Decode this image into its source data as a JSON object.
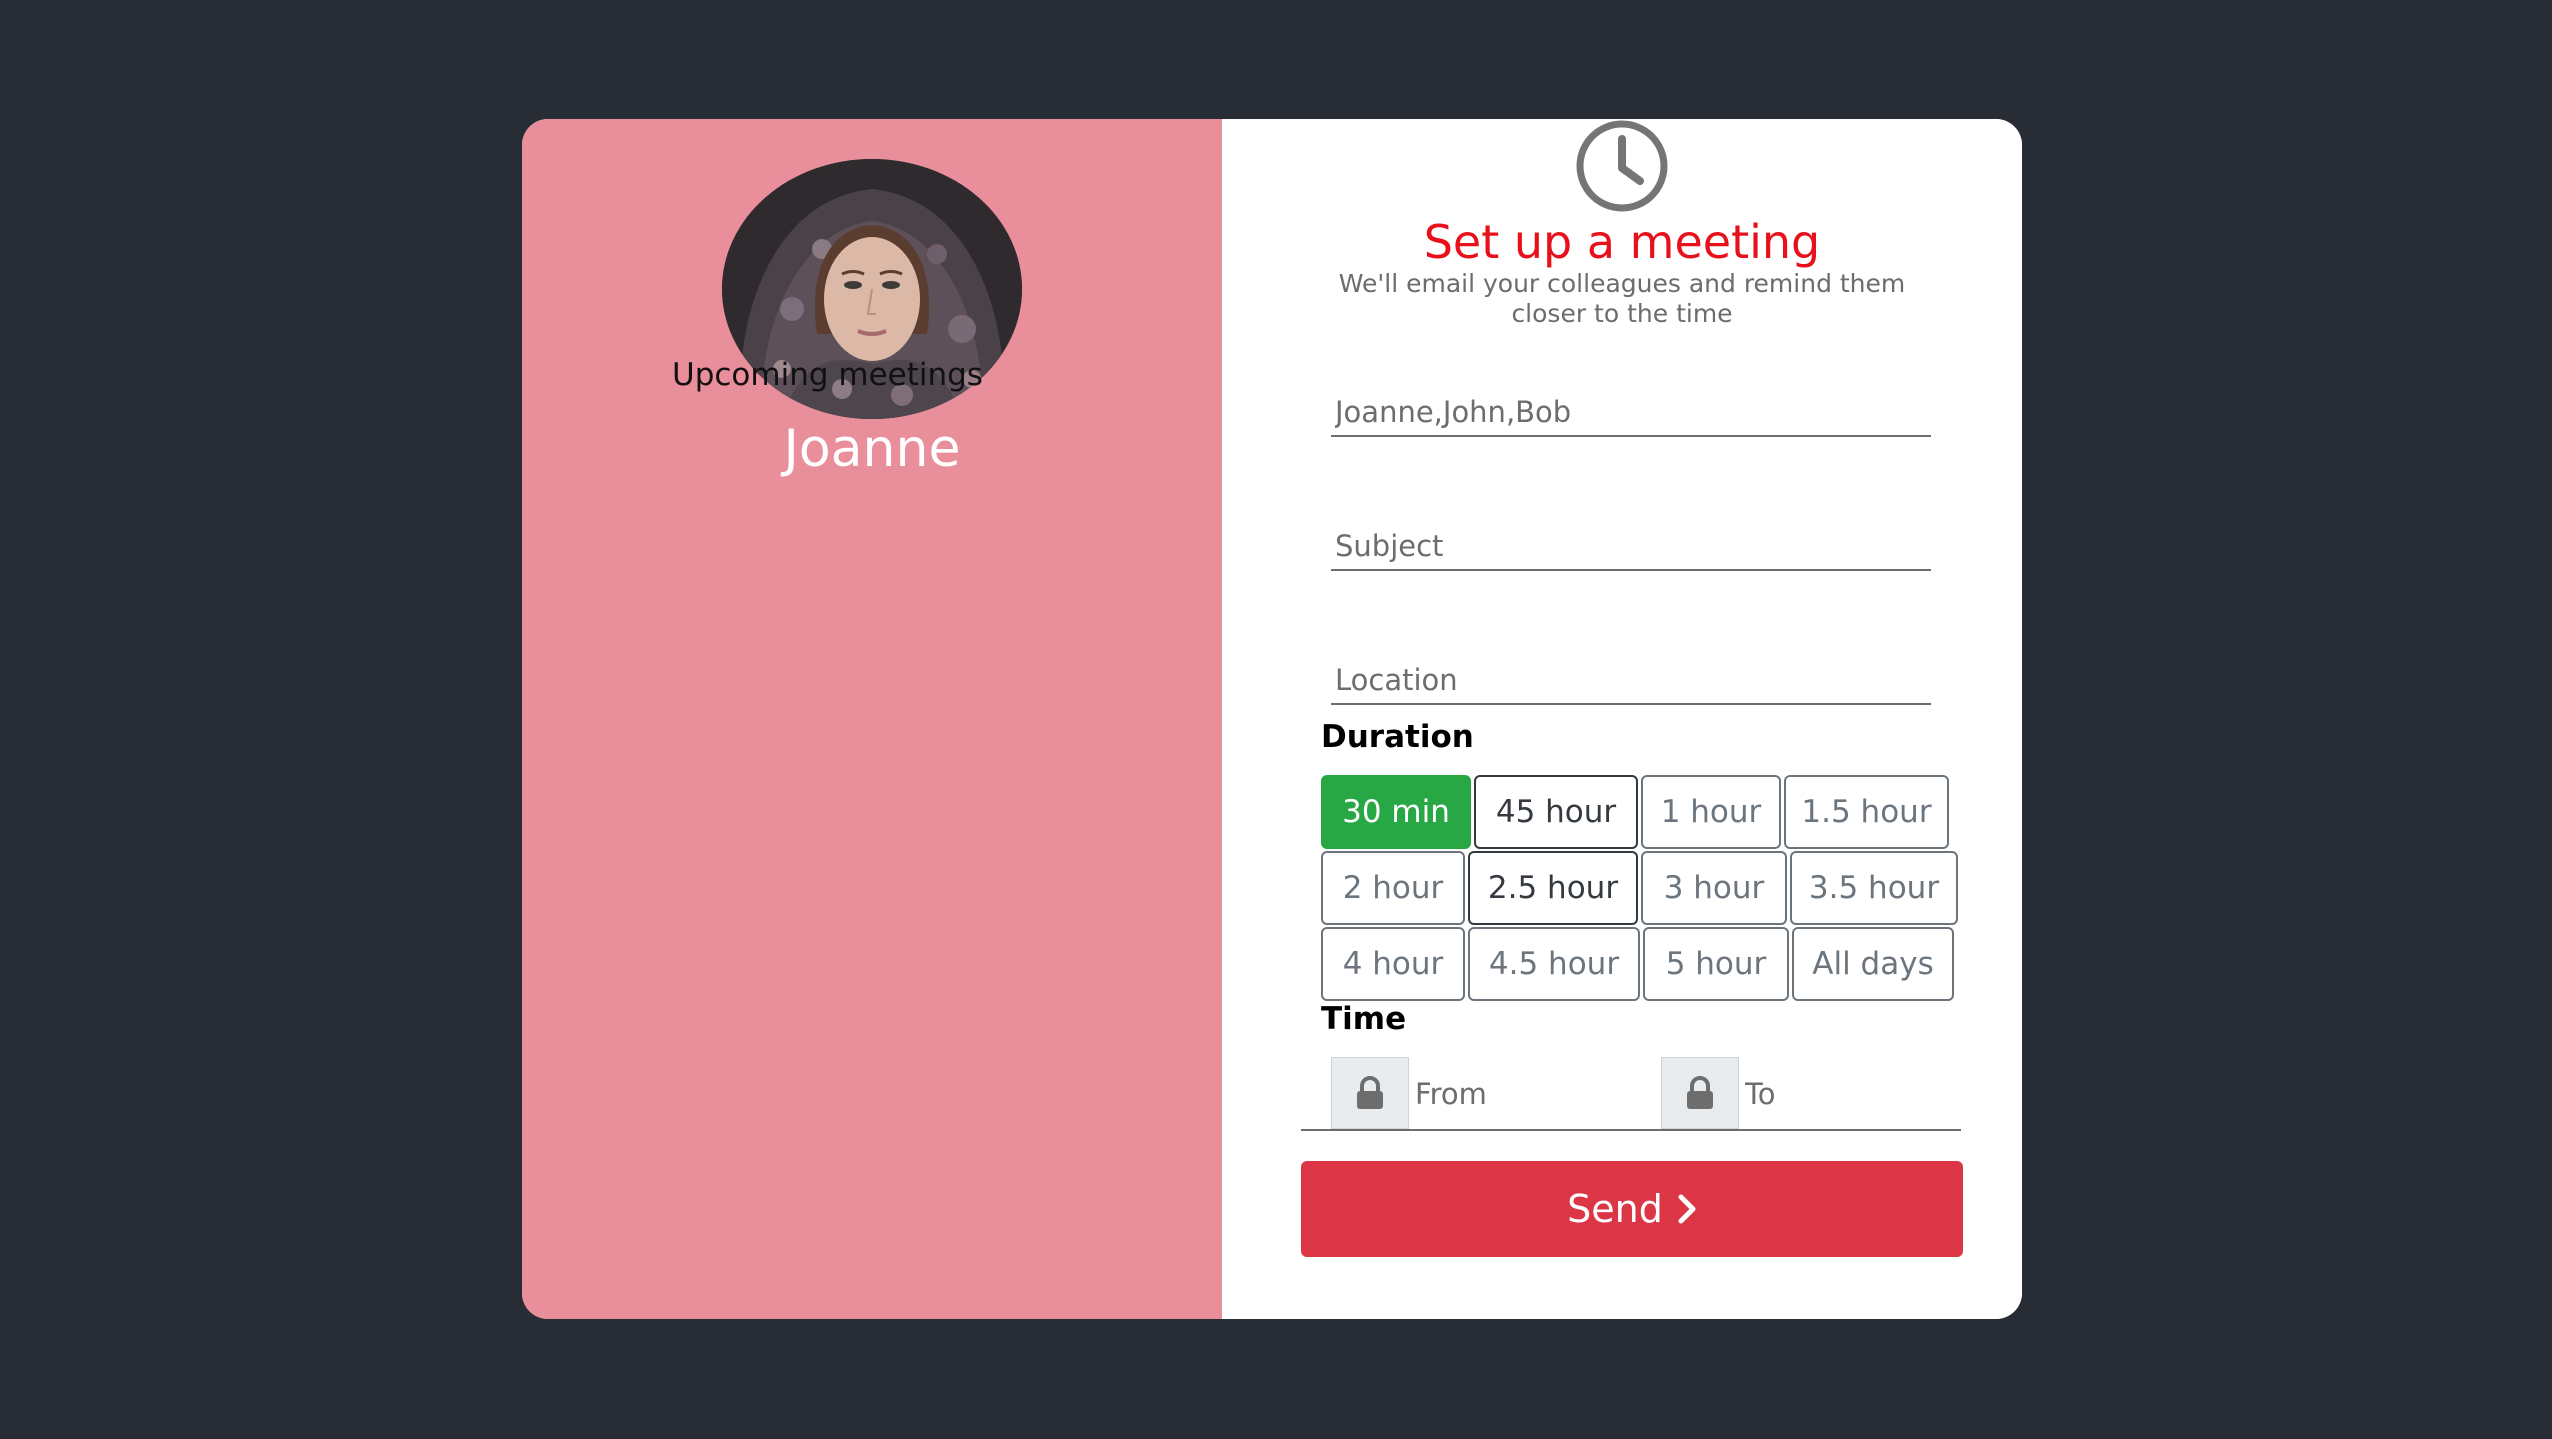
{
  "profile": {
    "upcoming_label": "Upcoming meetings",
    "name": "Joanne"
  },
  "form": {
    "icon": "clock-icon",
    "title": "Set up a meeting",
    "subtitle": "We'll email your colleagues and remind them closer to the time",
    "attendees_placeholder": "Joanne,John,Bob",
    "subject_placeholder": "Subject",
    "location_placeholder": "Location",
    "duration_label": "Duration",
    "durations": [
      "30 min",
      "45 hour",
      "1 hour",
      "1.5 hour",
      "2 hour",
      "2.5 hour",
      "3 hour",
      "3.5 hour",
      "4 hour",
      "4.5 hour",
      "5 hour",
      "All days"
    ],
    "selected_duration": "30 min",
    "time_label": "Time",
    "from_placeholder": "From",
    "to_placeholder": "To",
    "send_label": "Send"
  },
  "colors": {
    "background": "#282c34",
    "left_panel": "#e98e9b",
    "title": "#e8101b",
    "selected": "#28a745",
    "send": "#dc3545"
  }
}
